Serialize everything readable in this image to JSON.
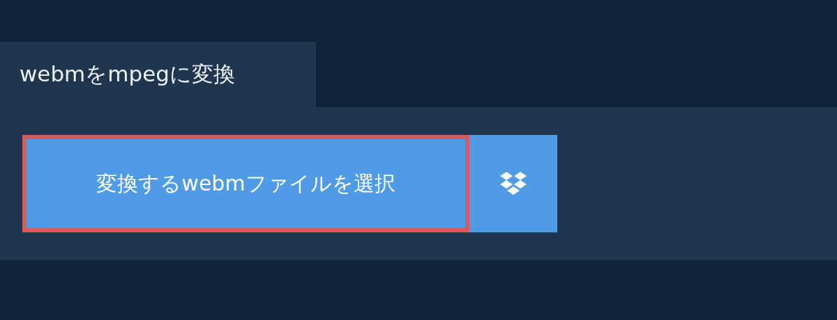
{
  "tab": {
    "title": "webmをmpegに変換"
  },
  "upload_button": {
    "label": "変換するwebmファイルを選択"
  }
}
